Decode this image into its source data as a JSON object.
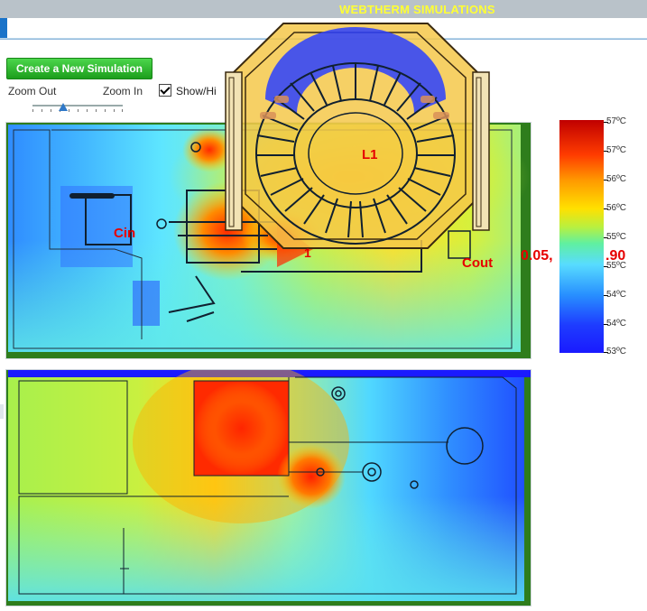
{
  "app": {
    "title": "WEBTHERM SIMULATIONS"
  },
  "toolbar": {
    "new_sim_label": "Create a New Simulation",
    "zoom_out_label": "Zoom Out",
    "zoom_in_label": "Zoom In",
    "show_hide_label": "Show/Hi",
    "show_hide_checked": true
  },
  "top_view": {
    "component_labels": {
      "l1": "L1",
      "cin": "Cin",
      "cout": "Cout",
      "u1": "1",
      "probe_a": "0.05,",
      "probe_b": ".90"
    }
  },
  "legend": {
    "labels": [
      "57ºC",
      "57ºC",
      "56ºC",
      "56ºC",
      "55ºC",
      "55ºC",
      "54ºC",
      "54ºC",
      "53ºC"
    ],
    "colors": {
      "hot": "#c00000",
      "cold": "#1a1aff"
    }
  },
  "colors": {
    "accent": "#1a73c9",
    "button_green": "#22aa22",
    "board_frame": "#2e7d1c",
    "label_red": "#e60000"
  }
}
